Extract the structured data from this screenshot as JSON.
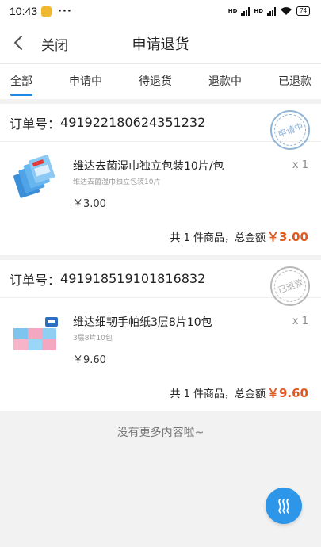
{
  "status_bar": {
    "time": "10:43",
    "dots": "···",
    "battery": "74",
    "network_1": "HD",
    "network_2": "HD"
  },
  "header": {
    "back_icon": "chevron-left-icon",
    "close_label": "关闭",
    "title": "申请退货"
  },
  "tabs": [
    {
      "label": "全部",
      "active": true
    },
    {
      "label": "申请中",
      "active": false
    },
    {
      "label": "待退货",
      "active": false
    },
    {
      "label": "退款中",
      "active": false
    },
    {
      "label": "已退款",
      "active": false
    }
  ],
  "orders": [
    {
      "order_label": "订单号：",
      "order_no": "491922180624351232",
      "stamp": "申请中",
      "product": {
        "name": "维达去菌湿巾独立包装10片/包",
        "spec": "维达去菌湿巾独立包装10片",
        "price": "￥3.00",
        "qty": "x 1"
      },
      "summary": "共 1 件商品，总金额",
      "total": "￥3.00"
    },
    {
      "order_label": "订单号：",
      "order_no": "491918519101816832",
      "stamp": "已退款",
      "product": {
        "name": "维达细韧手帕纸3层8片10包",
        "spec": "3层8片10包",
        "price": "￥9.60",
        "qty": "x 1"
      },
      "summary": "共 1 件商品，总金额",
      "total": "￥9.60"
    }
  ],
  "footer": {
    "no_more": "没有更多内容啦~"
  },
  "float_button": {
    "icon": "wave-icon"
  },
  "colors": {
    "accent": "#1e88e5",
    "price": "#e05a1f",
    "float_button": "#2e96e8"
  }
}
